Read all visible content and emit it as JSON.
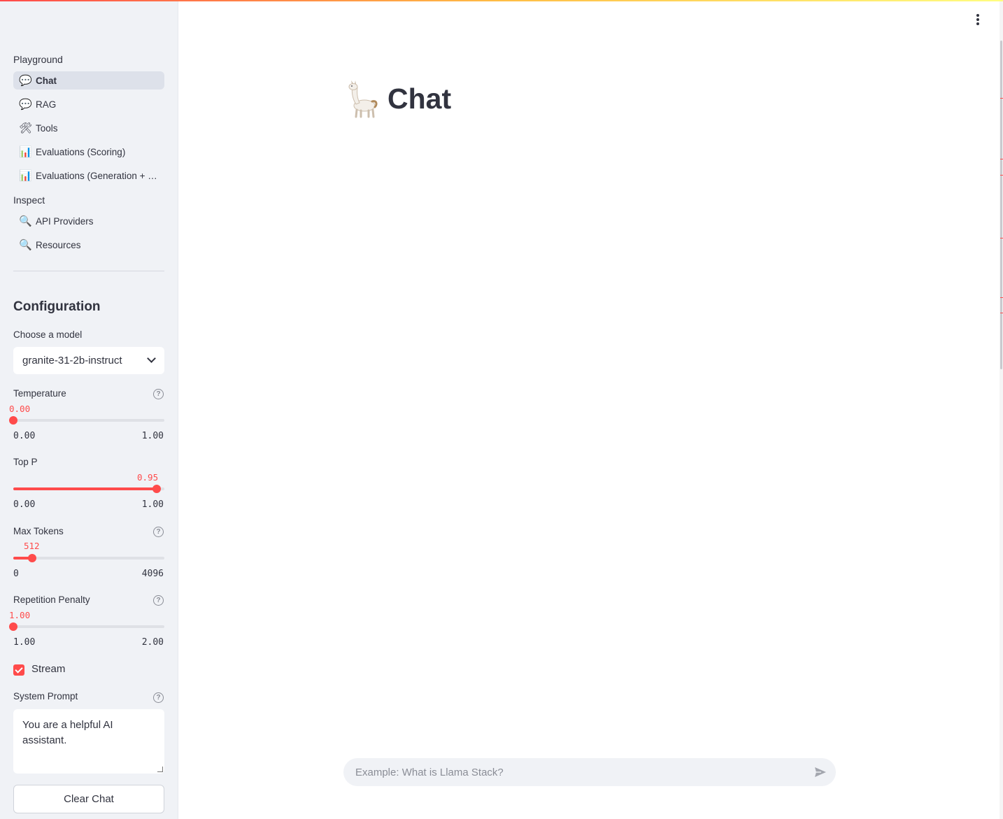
{
  "sidebar": {
    "sections": [
      {
        "title": "Playground",
        "items": [
          {
            "icon": "💬",
            "icon_name": "speech-bubble-icon",
            "label": "Chat",
            "active": true
          },
          {
            "icon": "💬",
            "icon_name": "speech-bubble-icon",
            "label": "RAG",
            "active": false
          },
          {
            "icon": "🛠",
            "icon_name": "tools-icon",
            "label": "Tools",
            "active": false
          },
          {
            "icon": "📊",
            "icon_name": "bar-chart-icon",
            "label": "Evaluations (Scoring)",
            "active": false
          },
          {
            "icon": "📊",
            "icon_name": "bar-chart-icon",
            "label": "Evaluations (Generation + S...",
            "active": false
          }
        ]
      },
      {
        "title": "Inspect",
        "items": [
          {
            "icon": "🔍",
            "icon_name": "magnifier-icon",
            "label": "API Providers",
            "active": false
          },
          {
            "icon": "🔍",
            "icon_name": "magnifier-icon",
            "label": "Resources",
            "active": false
          }
        ]
      }
    ]
  },
  "config": {
    "title": "Configuration",
    "model": {
      "label": "Choose a model",
      "value": "granite-31-2b-instruct"
    },
    "temperature": {
      "label": "Temperature",
      "value": "0.00",
      "min": "0.00",
      "max": "1.00",
      "fraction": 0.0
    },
    "top_p": {
      "label": "Top P",
      "value": "0.95",
      "min": "0.00",
      "max": "1.00",
      "fraction": 0.95
    },
    "max_tokens": {
      "label": "Max Tokens",
      "value": "512",
      "min": "0",
      "max": "4096",
      "fraction": 0.125
    },
    "repetition_penalty": {
      "label": "Repetition Penalty",
      "value": "1.00",
      "min": "1.00",
      "max": "2.00",
      "fraction": 0.0
    },
    "stream": {
      "label": "Stream",
      "checked": true
    },
    "system_prompt": {
      "label": "System Prompt",
      "value": "You are a helpful AI assistant."
    },
    "clear_label": "Clear Chat"
  },
  "main": {
    "title": "Chat",
    "input_placeholder": "Example: What is Llama Stack?"
  },
  "colors": {
    "accent": "#ff4b4b",
    "sidebar_bg": "#f0f2f6",
    "text": "#31333f"
  }
}
